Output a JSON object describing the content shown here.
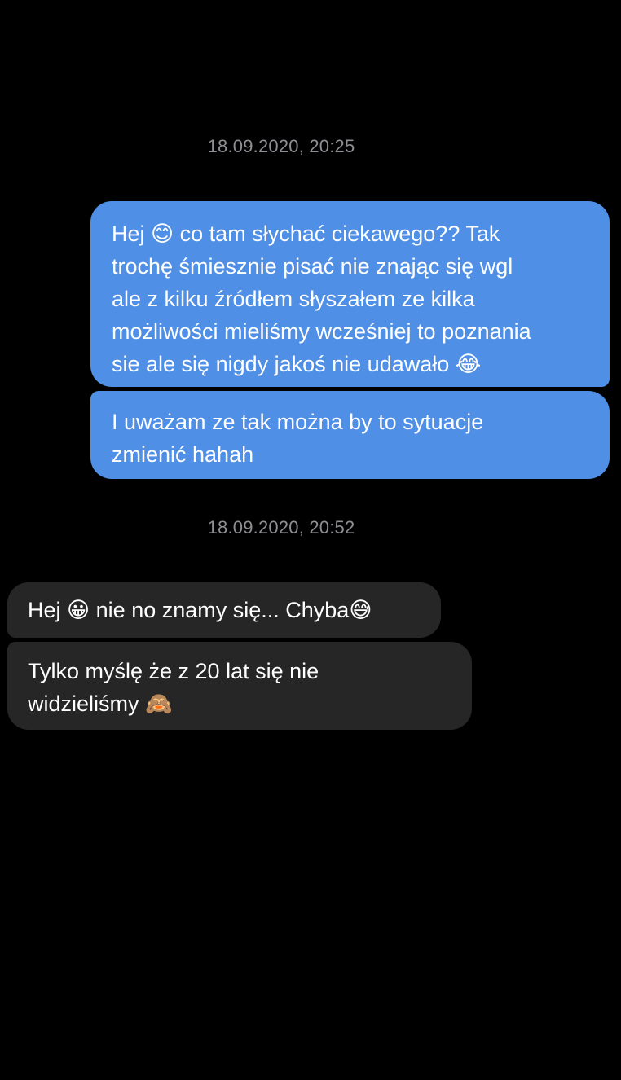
{
  "colors": {
    "background": "#000000",
    "outgoing_bubble": "#4f8fe6",
    "incoming_bubble": "#262626",
    "timestamp": "#8e8e93"
  },
  "conversation": {
    "timestamp_1": "18.09.2020, 20:25",
    "outgoing_message_1": "Hej 😊 co tam słychać ciekawego?? Tak\ntrochę śmiesznie pisać nie znając się wgl\nale z kilku źródłem słyszałem ze kilka\nmożliwości mieliśmy wcześniej to poznania\nsie ale się nigdy jakoś nie udawało 😂",
    "outgoing_message_2": "I uważam ze tak można by to sytuacje\nzmienić hahah",
    "timestamp_2": "18.09.2020, 20:52",
    "incoming_message_1": "Hej 😀 nie no znamy się... Chyba😅",
    "incoming_message_2": "Tylko myślę że z 20 lat się nie\nwidzieliśmy 🙈"
  }
}
